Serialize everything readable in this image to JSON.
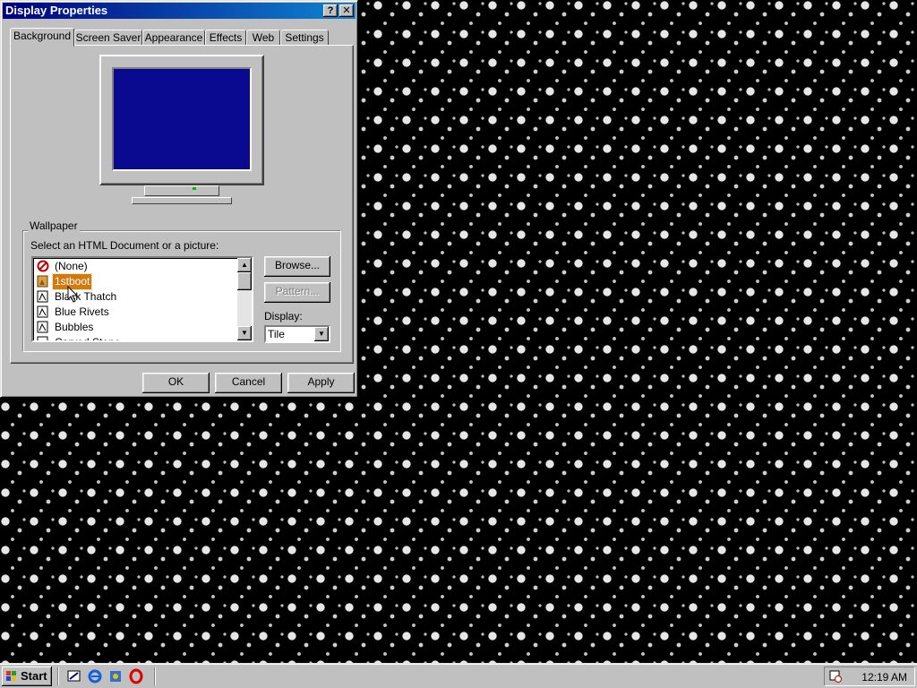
{
  "window": {
    "title": "Display Properties",
    "help_label": "?",
    "close_label": "✕"
  },
  "tabs": [
    "Background",
    "Screen Saver",
    "Appearance",
    "Effects",
    "Web",
    "Settings"
  ],
  "wallpaper": {
    "group_label": "Wallpaper",
    "prompt": "Select an HTML Document or a picture:",
    "items": [
      {
        "label": "(None)",
        "icon": "none-icon"
      },
      {
        "label": "1stboot",
        "icon": "image-file-icon"
      },
      {
        "label": "Black Thatch",
        "icon": "image-file-icon"
      },
      {
        "label": "Blue Rivets",
        "icon": "image-file-icon"
      },
      {
        "label": "Bubbles",
        "icon": "image-file-icon"
      },
      {
        "label": "Carved Stone",
        "icon": "image-file-icon"
      }
    ],
    "selected": "1stboot",
    "browse_label": "Browse...",
    "pattern_label": "Pattern...",
    "display_label": "Display:",
    "display_value": "Tile"
  },
  "buttons": {
    "ok": "OK",
    "cancel": "Cancel",
    "apply": "Apply"
  },
  "taskbar": {
    "start_label": "Start",
    "clock": "12:19 AM",
    "quick_launch": [
      "show-desktop-icon",
      "internet-explorer-icon",
      "channels-icon",
      "opera-icon"
    ]
  },
  "colors": {
    "title_start": "#000080",
    "title_end": "#1084d0",
    "selection": "#d07a10",
    "preview_screen": "#0a0a90"
  }
}
